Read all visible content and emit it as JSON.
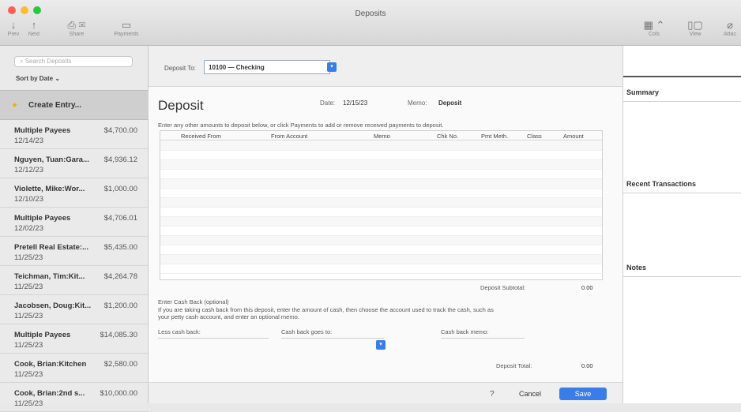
{
  "window": {
    "title": "Deposits"
  },
  "toolbar": {
    "prev": "Prev",
    "next": "Next",
    "share": "Share",
    "payments": "Payments",
    "cols": "Cols",
    "view": "View",
    "attach": "Attac"
  },
  "sidebar": {
    "search_placeholder": "Search Deposits",
    "sort": "Sort by Date",
    "create_entry": "Create Entry...",
    "items": [
      {
        "payee": "Multiple Payees",
        "amount": "$4,700.00",
        "date": "12/14/23"
      },
      {
        "payee": "Nguyen, Tuan:Gara...",
        "amount": "$4,936.12",
        "date": "12/12/23"
      },
      {
        "payee": "Violette, Mike:Wor...",
        "amount": "$1,000.00",
        "date": "12/10/23"
      },
      {
        "payee": "Multiple Payees",
        "amount": "$4,706.01",
        "date": "12/02/23"
      },
      {
        "payee": "Pretell Real Estate:...",
        "amount": "$5,435.00",
        "date": "11/25/23"
      },
      {
        "payee": "Teichman, Tim:Kit...",
        "amount": "$4,264.78",
        "date": "11/25/23"
      },
      {
        "payee": "Jacobsen, Doug:Kit...",
        "amount": "$1,200.00",
        "date": "11/25/23"
      },
      {
        "payee": "Multiple Payees",
        "amount": "$14,085.30",
        "date": "11/25/23"
      },
      {
        "payee": "Cook, Brian:Kitchen",
        "amount": "$2,580.00",
        "date": "11/25/23"
      },
      {
        "payee": "Cook, Brian:2nd s...",
        "amount": "$10,000.00",
        "date": "11/25/23"
      }
    ]
  },
  "form": {
    "deposit_to_label": "Deposit To:",
    "deposit_to_value": "10100 — Checking",
    "title": "Deposit",
    "date_label": "Date:",
    "date_value": "12/15/23",
    "memo_label": "Memo:",
    "memo_value": "Deposit",
    "instructions": "Enter any other amounts to deposit below, or click Payments to add or remove received payments to deposit.",
    "columns": [
      "Received From",
      "From Account",
      "Memo",
      "Chk No.",
      "Pmt Meth.",
      "Class",
      "Amount"
    ],
    "subtotal_label": "Deposit Subtotal:",
    "subtotal_value": "0.00",
    "cashback_title": "Enter Cash Back (optional)",
    "cashback_desc": "If you are taking cash back from this deposit, enter the amount of cash, then choose the account used to track the cash, such as your petty cash account, and enter an optional memo.",
    "less_cash_back": "Less cash back:",
    "cash_back_goes_to": "Cash back goes to:",
    "cash_back_memo": "Cash back memo:",
    "total_label": "Deposit Total:",
    "total_value": "0.00",
    "help": "?",
    "cancel": "Cancel",
    "save": "Save"
  },
  "right_panel": {
    "summary": "Summary",
    "recent": "Recent Transactions",
    "notes": "Notes"
  },
  "colors": {
    "accent": "#3b7de8"
  }
}
